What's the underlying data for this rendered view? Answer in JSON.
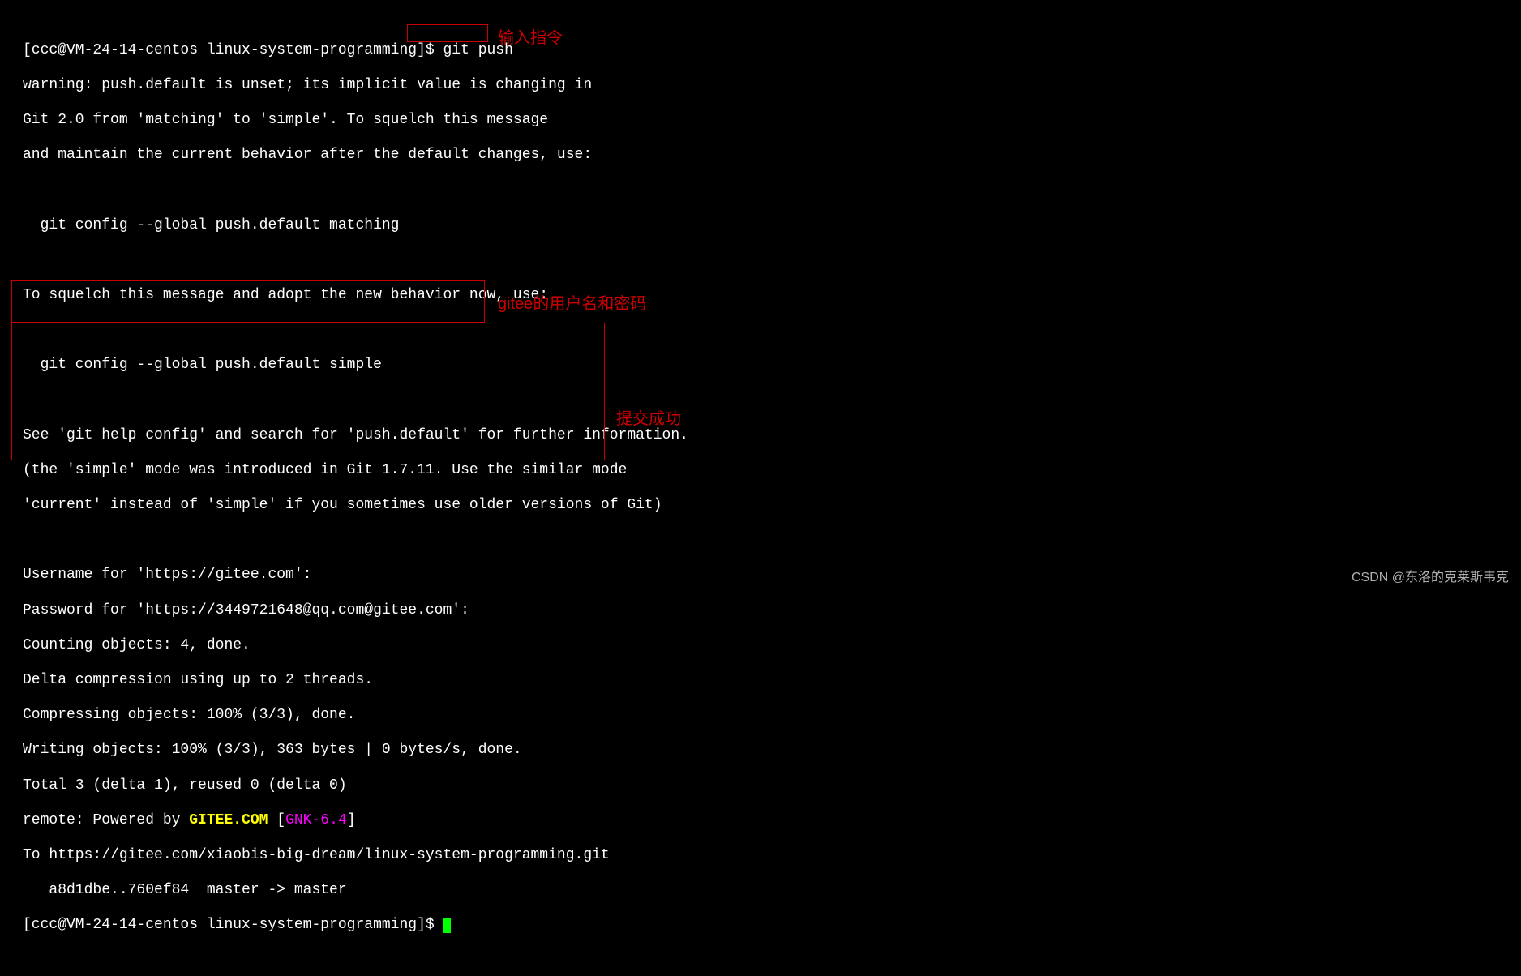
{
  "prompt1": "[ccc@VM-24-14-centos linux-system-programming]$ ",
  "command1": "git push",
  "lines": {
    "l1": "warning: push.default is unset; its implicit value is changing in",
    "l2": "Git 2.0 from 'matching' to 'simple'. To squelch this message",
    "l3": "and maintain the current behavior after the default changes, use:",
    "l4": "",
    "l5": "  git config --global push.default matching",
    "l6": "",
    "l7": "To squelch this message and adopt the new behavior now, use:",
    "l8": "",
    "l9": "  git config --global push.default simple",
    "l10": "",
    "l11": "See 'git help config' and search for 'push.default' for further information.",
    "l12": "(the 'simple' mode was introduced in Git 1.7.11. Use the similar mode",
    "l13": "'current' instead of 'simple' if you sometimes use older versions of Git)",
    "l14": "",
    "l15": "Username for 'https://gitee.com': ",
    "l16": "Password for 'https://3449721648@qq.com@gitee.com': ",
    "l17": "Counting objects: 4, done.",
    "l18": "Delta compression using up to 2 threads.",
    "l19": "Compressing objects: 100% (3/3), done.",
    "l20": "Writing objects: 100% (3/3), 363 bytes | 0 bytes/s, done.",
    "l21": "Total 3 (delta 1), reused 0 (delta 0)",
    "l22a": "remote: Powered by ",
    "l22b": "GITEE.COM ",
    "l22c": "[",
    "l22d": "GNK-6.4",
    "l22e": "]",
    "l23": "To https://gitee.com/xiaobis-big-dream/linux-system-programming.git",
    "l24": "   a8d1dbe..760ef84  master -> master"
  },
  "prompt2": "[ccc@VM-24-14-centos linux-system-programming]$ ",
  "annotations": {
    "a1": "输入指令",
    "a2": "gitee的用户名和密码",
    "a3": "提交成功"
  },
  "watermark": "CSDN @东洛的克莱斯韦克"
}
